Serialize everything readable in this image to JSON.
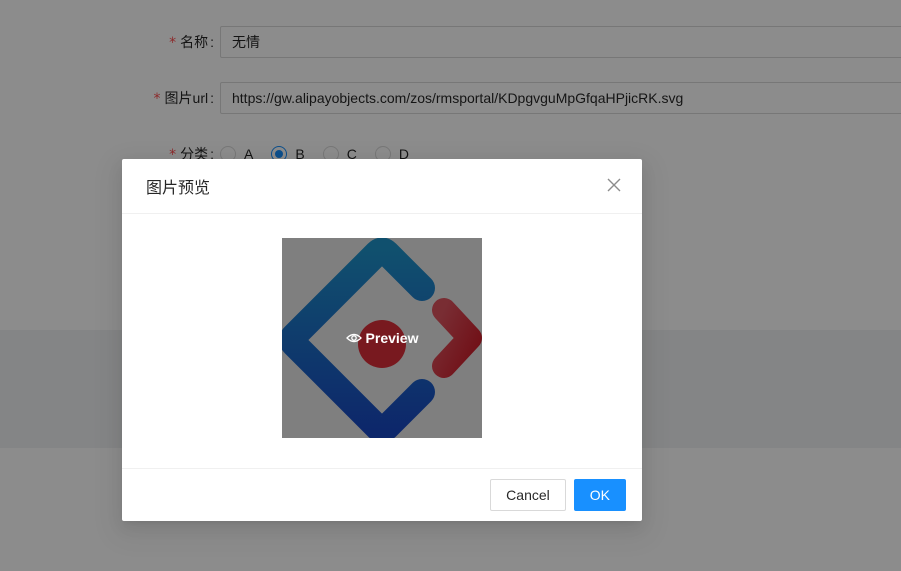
{
  "form": {
    "name": {
      "required_mark": "*",
      "label": "名称",
      "value": "无情"
    },
    "image_url": {
      "required_mark": "*",
      "label": "图片url",
      "value": "https://gw.alipayobjects.com/zos/rmsportal/KDpgvguMpGfqaHPjicRK.svg"
    },
    "category": {
      "required_mark": "*",
      "label": "分类",
      "options": [
        "A",
        "B",
        "C",
        "D"
      ],
      "selected": "B"
    }
  },
  "modal": {
    "title": "图片预览",
    "close_icon": "close-icon",
    "preview": {
      "overlay_label": "Preview",
      "overlay_icon": "eye-icon"
    },
    "cancel_label": "Cancel",
    "ok_label": "OK"
  },
  "colors": {
    "primary": "#1890ff",
    "required": "#ff4d4f",
    "mask": "rgba(0,0,0,0.45)"
  }
}
